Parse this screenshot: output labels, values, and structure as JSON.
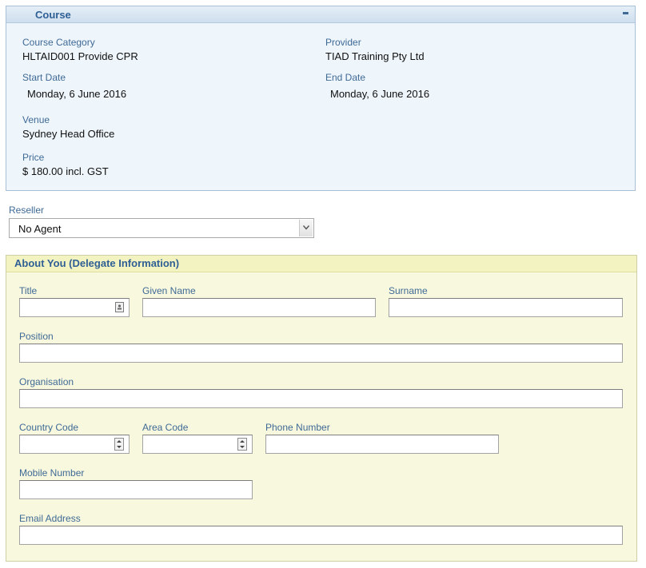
{
  "course": {
    "title": "Course",
    "category_label": "Course Category",
    "category_value": "HLTAID001 Provide CPR",
    "provider_label": "Provider",
    "provider_value": "TIAD Training Pty Ltd",
    "start_label": "Start Date",
    "start_value": "Monday, 6 June 2016",
    "end_label": "End Date",
    "end_value": "Monday, 6 June 2016",
    "venue_label": "Venue",
    "venue_value": "Sydney Head Office",
    "price_label": "Price",
    "price_value": "$ 180.00 incl. GST"
  },
  "reseller": {
    "label": "Reseller",
    "selected": "No Agent"
  },
  "about": {
    "title": "About You (Delegate Information)",
    "title_label": "Title",
    "given_name_label": "Given Name",
    "surname_label": "Surname",
    "position_label": "Position",
    "organisation_label": "Organisation",
    "country_code_label": "Country Code",
    "area_code_label": "Area Code",
    "phone_label": "Phone Number",
    "mobile_label": "Mobile Number",
    "email_label": "Email Address"
  }
}
